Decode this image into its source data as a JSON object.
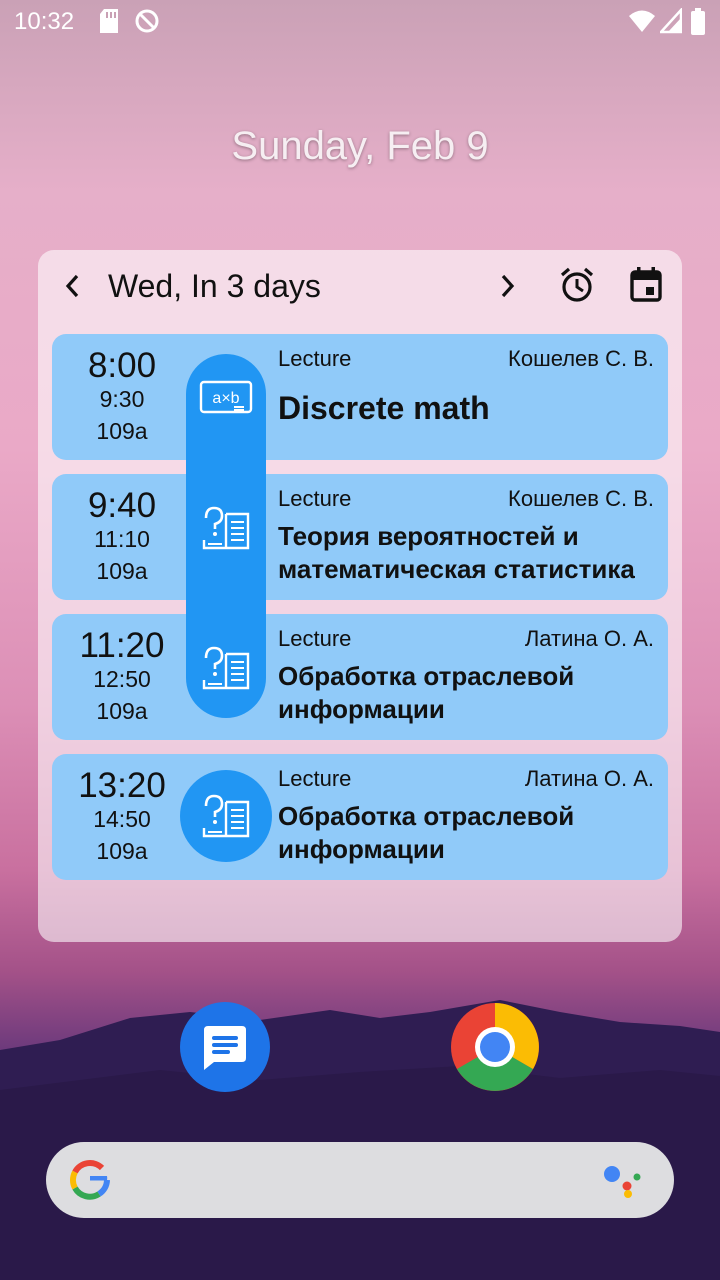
{
  "status_bar": {
    "time": "10:32",
    "icons": [
      "sd-card-icon",
      "no-sync-icon",
      "wifi-icon",
      "signal-icon",
      "battery-icon"
    ]
  },
  "home": {
    "date": "Sunday, Feb 9"
  },
  "widget": {
    "header_title": "Wed, In 3 days",
    "icons": [
      "chevron-left-icon",
      "chevron-right-icon",
      "alarm-icon",
      "calendar-icon"
    ],
    "lessons": [
      {
        "start": "8:00",
        "end": "9:30",
        "room": "109a",
        "type": "Lecture",
        "teacher": "Кошелев С. В.",
        "title": "Discrete math",
        "icon": "math-formula-icon"
      },
      {
        "start": "9:40",
        "end": "11:10",
        "room": "109a",
        "type": "Lecture",
        "teacher": "Кошелев С. В.",
        "title": "Теория вероятностей и математическая статистика",
        "icon": "question-book-icon"
      },
      {
        "start": "11:20",
        "end": "12:50",
        "room": "109a",
        "type": "Lecture",
        "teacher": "Латина О. А.",
        "title": "Обработка отраслевой информации",
        "icon": "question-book-icon"
      },
      {
        "start": "13:20",
        "end": "14:50",
        "room": "109a",
        "type": "Lecture",
        "teacher": "Латина О. А.",
        "title": "Обработка отраслевой информации",
        "icon": "question-book-icon"
      }
    ]
  },
  "dock": {
    "apps": [
      "messages-icon",
      "chrome-icon"
    ]
  },
  "search": {
    "icons": [
      "google-logo-icon",
      "assistant-icon"
    ]
  },
  "colors": {
    "card": "#90caf9",
    "accent": "#2196f3"
  }
}
